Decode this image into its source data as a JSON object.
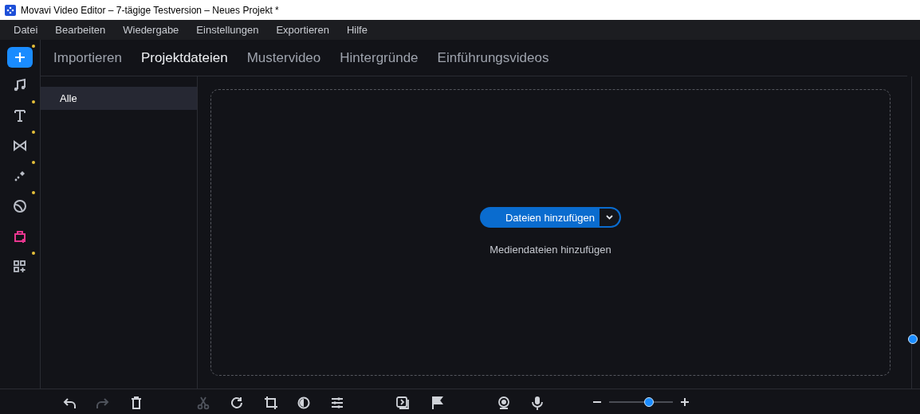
{
  "window": {
    "title": "Movavi Video Editor – 7-tägige Testversion – Neues Projekt *"
  },
  "menu": [
    "Datei",
    "Bearbeiten",
    "Wiedergabe",
    "Einstellungen",
    "Exportieren",
    "Hilfe"
  ],
  "sidebar": [
    {
      "selected": true,
      "badge": true
    },
    {
      "selected": false,
      "badge": false
    },
    {
      "selected": false,
      "badge": true
    },
    {
      "selected": false,
      "badge": true
    },
    {
      "selected": false,
      "badge": true
    },
    {
      "selected": false,
      "badge": true
    },
    {
      "selected": false,
      "badge": false
    },
    {
      "selected": false,
      "badge": true
    }
  ],
  "tabs": [
    {
      "label": "Importieren",
      "selected": false
    },
    {
      "label": "Projektdateien",
      "selected": true
    },
    {
      "label": "Mustervideo",
      "selected": false
    },
    {
      "label": "Hintergründe",
      "selected": false
    },
    {
      "label": "Einführungsvideos",
      "selected": false
    }
  ],
  "categories": [
    {
      "label": "Alle",
      "selected": true
    }
  ],
  "dropzone": {
    "button": "Dateien hinzufügen",
    "hint": "Mediendateien hinzufügen"
  },
  "toolbar": [
    {
      "disabled": false
    },
    {
      "disabled": true
    },
    {
      "disabled": false
    },
    {
      "disabled": true
    },
    {
      "disabled": false
    },
    {
      "disabled": false
    },
    {
      "disabled": false
    },
    {
      "disabled": false
    },
    {
      "disabled": false
    },
    {
      "disabled": false
    },
    {
      "disabled": false
    },
    {
      "disabled": false
    }
  ],
  "zoom": {
    "level": 0.62
  }
}
